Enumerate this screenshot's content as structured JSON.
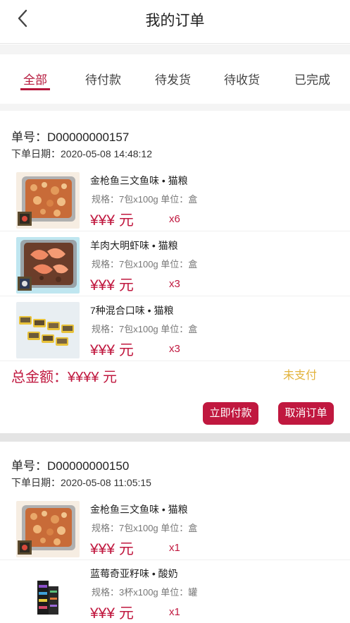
{
  "header": {
    "title": "我的订单"
  },
  "tabs": [
    {
      "label": "全部"
    },
    {
      "label": "待付款"
    },
    {
      "label": "待发货"
    },
    {
      "label": "待收货"
    },
    {
      "label": "已完成"
    }
  ],
  "active_tab": "全部",
  "orders": [
    {
      "order_no": "单号：D00000000157",
      "date": "下单日期：2020-05-08 14:48:12",
      "items": [
        {
          "name": "金枪鱼三文鱼味 • 猫粮",
          "spec": "规格：7包x100g   单位：盒",
          "price": "¥¥¥ 元",
          "qty": "x6",
          "icon": "salmon-cat-food-tray"
        },
        {
          "name": "羊肉大明虾味 • 猫粮",
          "spec": "规格：7包x100g   单位：盒",
          "price": "¥¥¥ 元",
          "qty": "x3",
          "icon": "shrimp-cat-food-tray"
        },
        {
          "name": "7种混合口味 • 猫粮",
          "spec": "规格：7包x100g   单位：盒",
          "price": "¥¥¥ 元",
          "qty": "x3",
          "icon": "mixed-cat-food-trays"
        }
      ],
      "total": "总金额：¥¥¥¥ 元",
      "status": "未支付",
      "pay_label": "立即付款",
      "cancel_label": "取消订单"
    },
    {
      "order_no": "单号：D00000000150",
      "date": "下单日期：2020-05-08 11:05:15",
      "items": [
        {
          "name": "金枪鱼三文鱼味 • 猫粮",
          "spec": "规格：7包x100g   单位：盒",
          "price": "¥¥¥ 元",
          "qty": "x1",
          "icon": "salmon-cat-food-tray"
        },
        {
          "name": "蓝莓奇亚籽味 • 酸奶",
          "spec": "规格：3杯x100g   单位：罐",
          "price": "¥¥¥ 元",
          "qty": "x1",
          "icon": "yogurt-cups"
        }
      ]
    }
  ],
  "colors": {
    "accent": "#c0183f",
    "status_unpaid": "#e2b33c",
    "divider": "#f4f4f4"
  }
}
